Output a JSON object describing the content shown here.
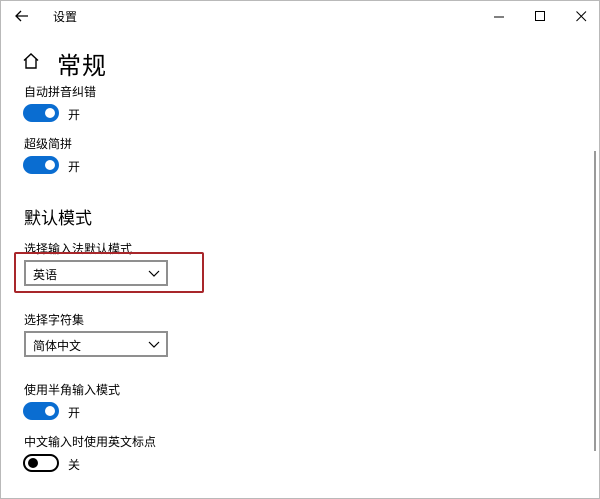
{
  "window": {
    "title": "设置"
  },
  "header": {
    "title": "常规"
  },
  "settings": {
    "pinyin_correction": {
      "label": "自动拼音纠错",
      "state": "开"
    },
    "super_jianpin": {
      "label": "超级简拼",
      "state": "开"
    },
    "default_mode_section": "默认模式",
    "input_default_mode": {
      "label": "选择输入法默认模式",
      "value": "英语"
    },
    "charset": {
      "label": "选择字符集",
      "value": "简体中文"
    },
    "halfwidth_mode": {
      "label": "使用半角输入模式",
      "state": "开"
    },
    "english_punct": {
      "label": "中文输入时使用英文标点",
      "state": "关"
    }
  },
  "colors": {
    "accent": "#0a6dd1",
    "highlight": "#a8262a"
  }
}
